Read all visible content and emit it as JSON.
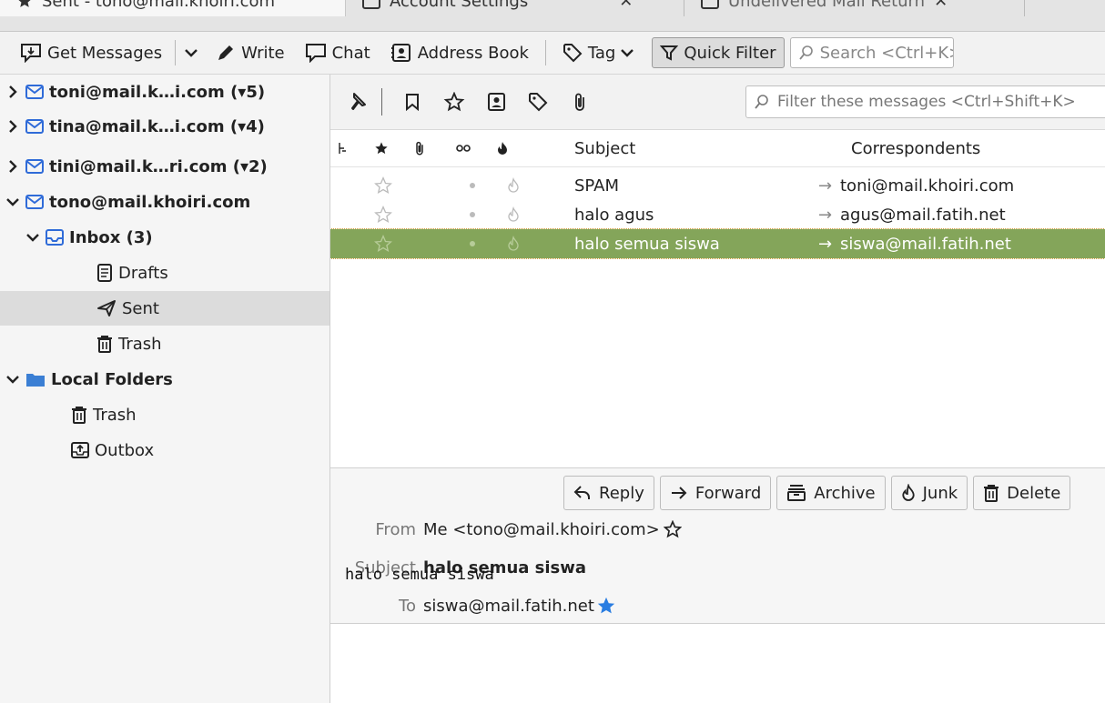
{
  "tabs": [
    {
      "label": "Sent - tono@mail.khoiri.com"
    },
    {
      "label": "Account Settings"
    },
    {
      "label": "Undelivered Mail Return"
    }
  ],
  "toolbar": {
    "get_messages": "Get Messages",
    "write": "Write",
    "chat": "Chat",
    "address_book": "Address Book",
    "tag": "Tag",
    "quick_filter": "Quick Filter",
    "search_placeholder": "Search <Ctrl+K>"
  },
  "folders": {
    "accounts": [
      {
        "label": "toni@mail.k…i.com (▾5)"
      },
      {
        "label": "tina@mail.k…i.com (▾4)"
      },
      {
        "label": "tini@mail.k…ri.com (▾2)"
      },
      {
        "label": "tono@mail.khoiri.com"
      }
    ],
    "inbox": "Inbox (3)",
    "drafts": "Drafts",
    "sent": "Sent",
    "trash": "Trash",
    "local_folders": "Local Folders",
    "local_trash": "Trash",
    "outbox": "Outbox"
  },
  "filter_placeholder": "Filter these messages <Ctrl+Shift+K>",
  "columns": {
    "subject": "Subject",
    "correspondents": "Correspondents"
  },
  "messages": [
    {
      "subject": "SPAM",
      "correspondent": "toni@mail.khoiri.com"
    },
    {
      "subject": "halo agus",
      "correspondent": "agus@mail.fatih.net"
    },
    {
      "subject": "halo semua siswa",
      "correspondent": "siswa@mail.fatih.net"
    }
  ],
  "header_buttons": {
    "reply": "Reply",
    "forward": "Forward",
    "archive": "Archive",
    "junk": "Junk",
    "delete": "Delete"
  },
  "message_header": {
    "from_label": "From",
    "from_value": "Me <tono@mail.khoiri.com>",
    "subject_label": "Subject",
    "subject_value": "halo semua siswa",
    "to_label": "To",
    "to_value": "siswa@mail.fatih.net"
  },
  "body_text": "halo semua siswa",
  "colors": {
    "accent": "#84a55a",
    "mail_icon": "#2f6bd8",
    "star": "#2a7de1",
    "folder": "#3b7fd4"
  }
}
